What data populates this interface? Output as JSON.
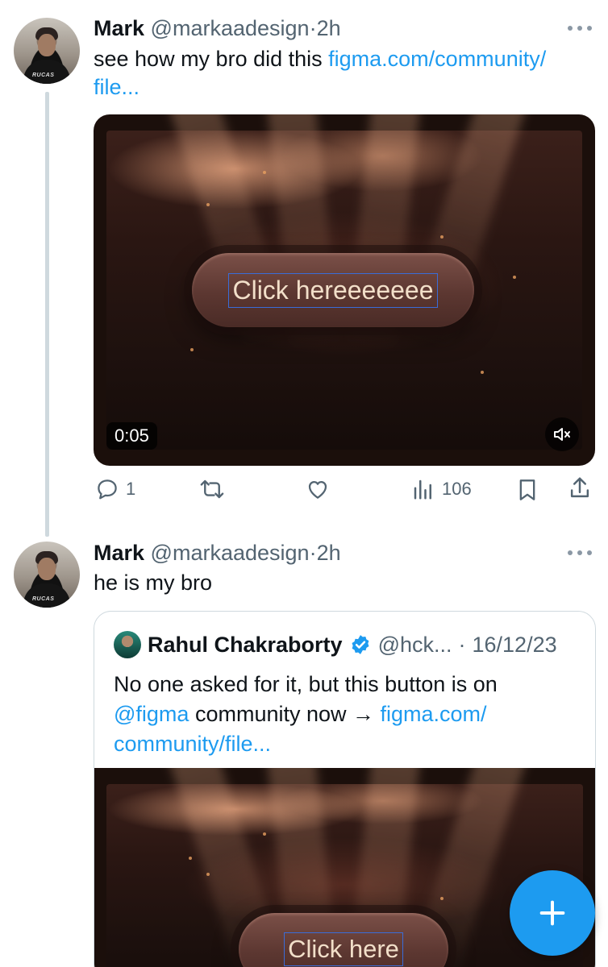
{
  "tweets": [
    {
      "name": "Mark",
      "handle": "@markaadesign",
      "dot": "·",
      "time": "2h",
      "text": "see how my bro did this ",
      "link": "figma.com/community/file...",
      "link_line1": "figma.com/community/",
      "link_line2": "file...",
      "avatar_shirt_text": "RUCAS",
      "media": {
        "button_label": "Click hereeeeeee",
        "duration": "0:05"
      },
      "actions": {
        "replies": "1",
        "retweets": "",
        "likes": "",
        "views": "106"
      }
    },
    {
      "name": "Mark",
      "handle": "@markaadesign",
      "dot": "·",
      "time": "2h",
      "text": "he is my bro",
      "avatar_shirt_text": "RUCAS"
    }
  ],
  "quote": {
    "name": "Rahul Chakraborty",
    "handle": "@hck...",
    "dot": "·",
    "date": "16/12/23",
    "text_line1": "No one asked for it, but this button is on",
    "mention": "@figma",
    "text_mid": " community now → ",
    "link_a": "figma.com/",
    "link_b": "community/file...",
    "media_button_label": "Click here"
  },
  "colors": {
    "accent": "#1d9bf0",
    "muted": "#536471",
    "text": "#0f1419"
  }
}
